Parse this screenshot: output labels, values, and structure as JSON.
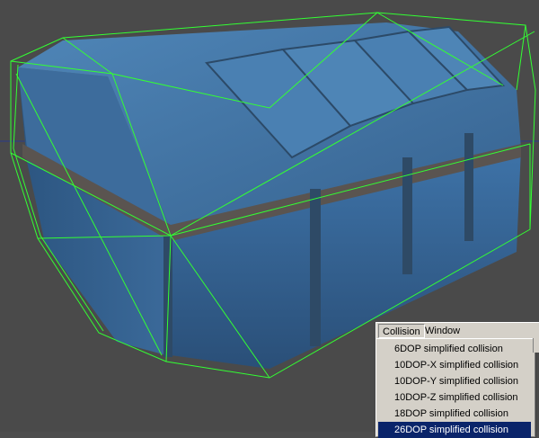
{
  "viewport": {
    "background": "#4a4a4a",
    "axis_color": "#2a3a8a",
    "collision_wire_color": "#33ff33",
    "mesh_color": "#3f6e9f"
  },
  "menubar": {
    "items": [
      {
        "label": "Collision",
        "active": true
      },
      {
        "label": "Window",
        "active": false
      }
    ]
  },
  "collision_menu": {
    "items": [
      {
        "label": "6DOP simplified collision",
        "selected": false
      },
      {
        "label": "10DOP-X simplified collision",
        "selected": false
      },
      {
        "label": "10DOP-Y simplified collision",
        "selected": false
      },
      {
        "label": "10DOP-Z simplified collision",
        "selected": false
      },
      {
        "label": "18DOP simplified collision",
        "selected": false
      },
      {
        "label": "26DOP simplified collision",
        "selected": true
      }
    ]
  }
}
